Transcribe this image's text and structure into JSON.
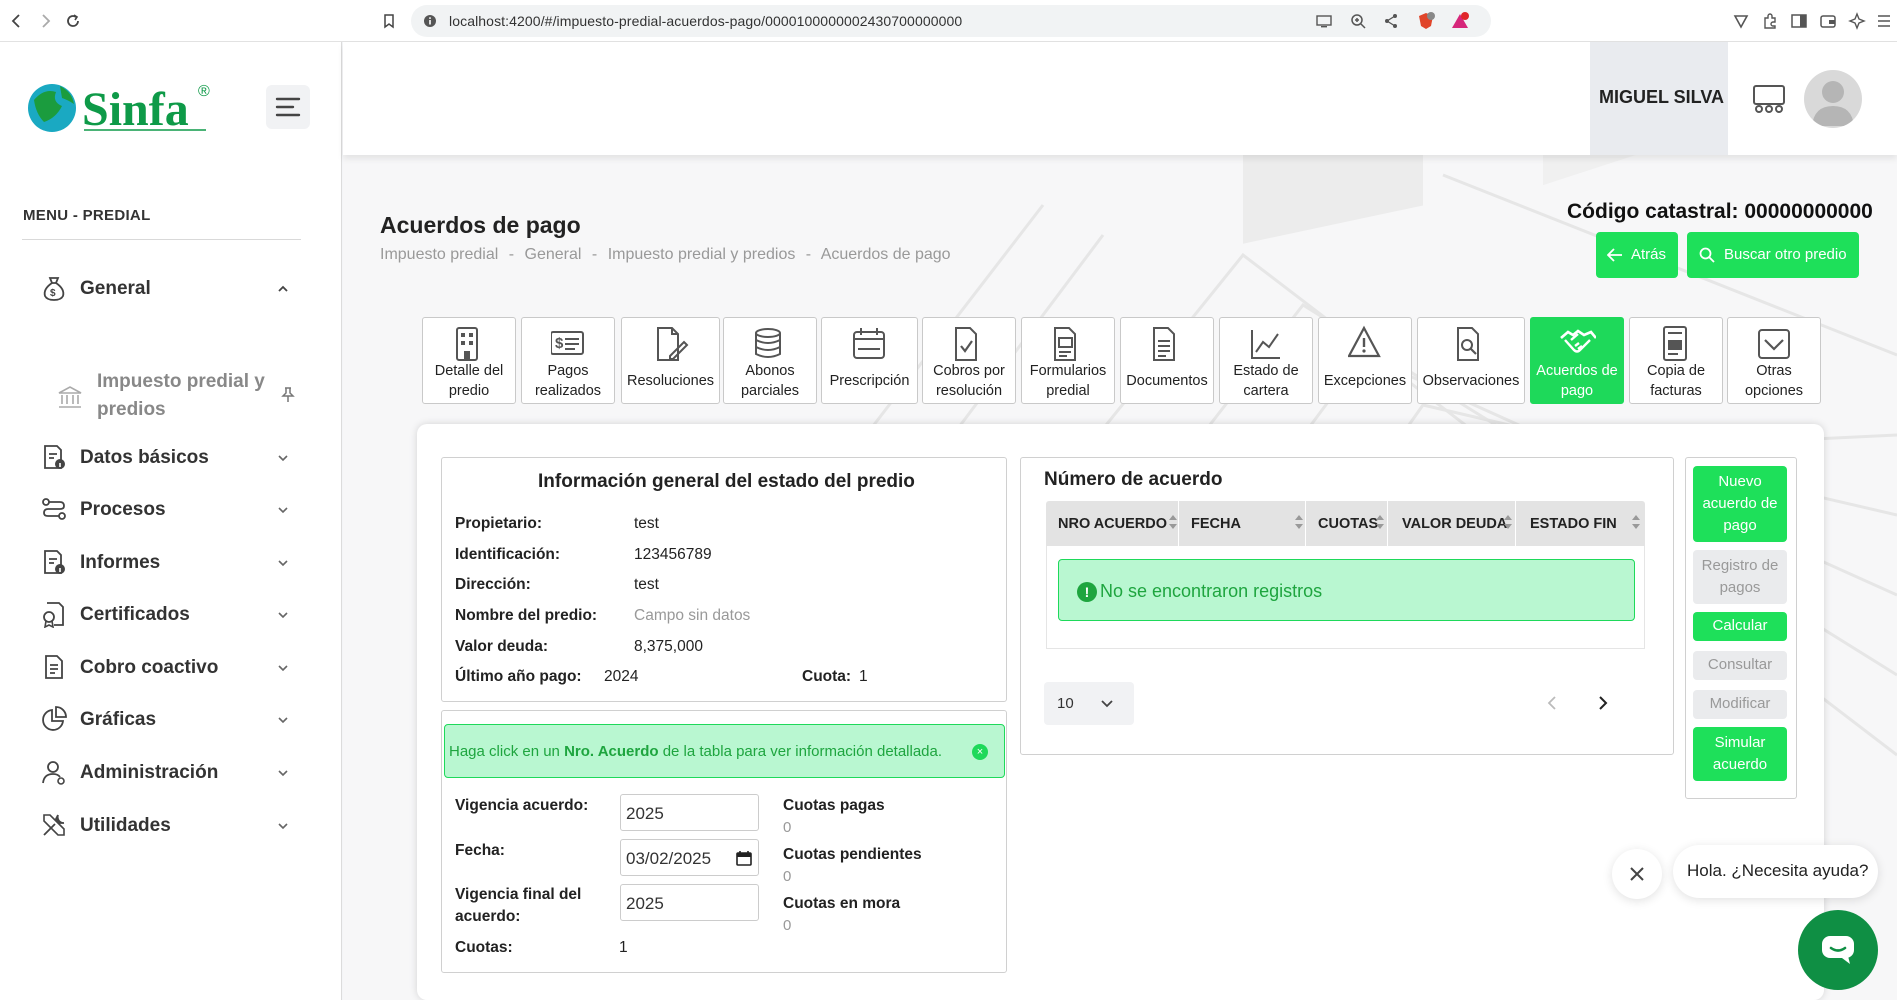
{
  "browser": {
    "url": "localhost:4200/#/impuesto-predial-acuerdos-pago/0000100000002430700000000"
  },
  "sidebar": {
    "logo_text": "Sinfa",
    "logo_mark": "®",
    "menu_title": "MENU - PREDIAL",
    "items": [
      {
        "label": "General",
        "icon": "moneybag-icon",
        "expanded": true
      },
      {
        "label": "Datos básicos",
        "icon": "document-info-icon"
      },
      {
        "label": "Procesos",
        "icon": "process-icon"
      },
      {
        "label": "Informes",
        "icon": "report-icon"
      },
      {
        "label": "Certificados",
        "icon": "certificate-icon"
      },
      {
        "label": "Cobro coactivo",
        "icon": "file-icon"
      },
      {
        "label": "Gráficas",
        "icon": "pie-chart-icon"
      },
      {
        "label": "Administración",
        "icon": "user-admin-icon"
      },
      {
        "label": "Utilidades",
        "icon": "tools-icon"
      }
    ],
    "sub_item": {
      "label": "Impuesto predial y predios",
      "icon": "bank-icon"
    }
  },
  "header": {
    "user_name": "MIGUEL SILVA"
  },
  "page": {
    "title": "Acuerdos de pago",
    "breadcrumb": [
      "Impuesto predial",
      "General",
      "Impuesto predial y predios",
      "Acuerdos de pago"
    ],
    "breadcrumb_sep": "-",
    "codigo_label": "Código catastral:",
    "codigo_value": "00000000000",
    "back_label": "Atrás",
    "search_label": "Buscar otro predio"
  },
  "tabs": [
    {
      "l1": "Detalle del",
      "l2": "predio"
    },
    {
      "l1": "Pagos",
      "l2": "realizados"
    },
    {
      "l1": "Resoluciones",
      "l2": ""
    },
    {
      "l1": "Abonos",
      "l2": "parciales"
    },
    {
      "l1": "Prescripción",
      "l2": ""
    },
    {
      "l1": "Cobros por",
      "l2": "resolución"
    },
    {
      "l1": "Formularios",
      "l2": "predial"
    },
    {
      "l1": "Documentos",
      "l2": ""
    },
    {
      "l1": "Estado de",
      "l2": "cartera"
    },
    {
      "l1": "Excepciones",
      "l2": ""
    },
    {
      "l1": "Observaciones",
      "l2": ""
    },
    {
      "l1": "Acuerdos de",
      "l2": "pago",
      "active": true
    },
    {
      "l1": "Copia de",
      "l2": "facturas"
    },
    {
      "l1": "Otras",
      "l2": "opciones"
    }
  ],
  "info": {
    "title": "Información general del estado del predio",
    "propietario_label": "Propietario:",
    "propietario": "test",
    "identificacion_label": "Identificación:",
    "identificacion": "123456789",
    "direccion_label": "Dirección:",
    "direccion": "test",
    "nombre_label": "Nombre del predio:",
    "nombre": "Campo sin datos",
    "valor_label": "Valor deuda:",
    "valor": "8,375,000",
    "ultimo_label": "Último año pago:",
    "ultimo": "2024",
    "cuota_label": "Cuota:",
    "cuota": "1"
  },
  "alert": {
    "pre": "Haga click en un ",
    "bold": "Nro. Acuerdo",
    "post": " de la tabla para ver información detallada.",
    "close": "×"
  },
  "form": {
    "vigencia_label": "Vigencia acuerdo:",
    "vigencia": "2025",
    "fecha_label": "Fecha:",
    "fecha": "03/02/2025",
    "vigencia_final_label_1": "Vigencia final del",
    "vigencia_final_label_2": "acuerdo:",
    "vigencia_final": "2025",
    "cuotas_label": "Cuotas:",
    "cuotas": "1",
    "cuotas_pagas_label": "Cuotas pagas",
    "cuotas_pagas": "0",
    "cuotas_pendientes_label": "Cuotas pendientes",
    "cuotas_pendientes": "0",
    "cuotas_mora_label": "Cuotas en mora",
    "cuotas_mora": "0"
  },
  "table": {
    "title": "Número de acuerdo",
    "columns": [
      "NRO ACUERDO",
      "FECHA",
      "CUOTAS",
      "VALOR DEUDA",
      "ESTADO FIN"
    ],
    "rows": [],
    "empty_message": "No se encontraron registros",
    "page_size": "10"
  },
  "actions": {
    "nuevo_1": "Nuevo",
    "nuevo_2": "acuerdo de",
    "nuevo_3": "pago",
    "registro_1": "Registro de",
    "registro_2": "pagos",
    "calcular": "Calcular",
    "consultar": "Consultar",
    "modificar": "Modificar",
    "simular_1": "Simular",
    "simular_2": "acuerdo"
  },
  "chat": {
    "message": "Hola. ¿Necesita ayuda?"
  },
  "colors": {
    "accent": "#1ee05a",
    "brand_green": "#0e9a48",
    "chat": "#0f8f44",
    "alert_bg": "#b9f7d1"
  }
}
